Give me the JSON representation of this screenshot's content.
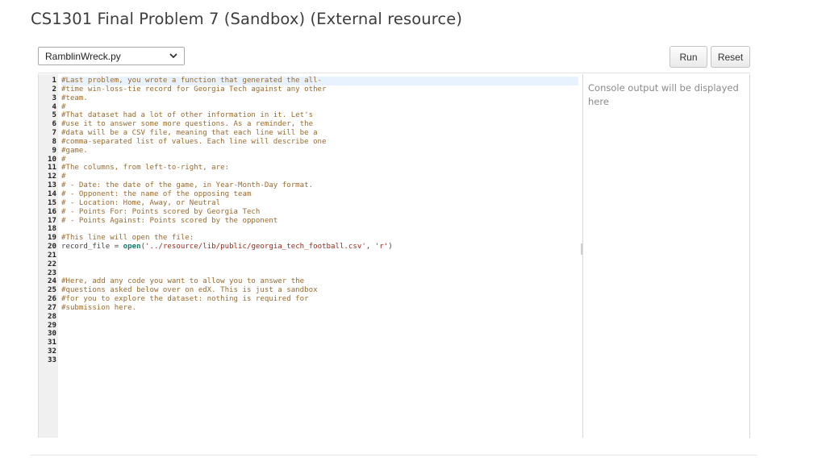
{
  "page": {
    "title": "CS1301 Final Problem 7 (Sandbox) (External resource)"
  },
  "toolbar": {
    "file_select_value": "RamblinWreck.py",
    "run_label": "Run",
    "reset_label": "Reset"
  },
  "editor": {
    "active_line": 1,
    "lines": [
      {
        "n": "1",
        "text": "#Last problem, you wrote a function that generated the all-"
      },
      {
        "n": "2",
        "text": "#time win-loss-tie record for Georgia Tech against any other"
      },
      {
        "n": "3",
        "text": "#team."
      },
      {
        "n": "4",
        "text": "#"
      },
      {
        "n": "5",
        "text": "#That dataset had a lot of other information in it. Let's"
      },
      {
        "n": "6",
        "text": "#use it to answer some more questions. As a reminder, the"
      },
      {
        "n": "7",
        "text": "#data will be a CSV file, meaning that each line will be a"
      },
      {
        "n": "8",
        "text": "#comma-separated list of values. Each line will describe one"
      },
      {
        "n": "9",
        "text": "#game."
      },
      {
        "n": "10",
        "text": "#"
      },
      {
        "n": "11",
        "text": "#The columns, from left-to-right, are:"
      },
      {
        "n": "12",
        "text": "#"
      },
      {
        "n": "13",
        "text": "# - Date: the date of the game, in Year-Month-Day format."
      },
      {
        "n": "14",
        "text": "# - Opponent: the name of the opposing team"
      },
      {
        "n": "15",
        "text": "# - Location: Home, Away, or Neutral"
      },
      {
        "n": "16",
        "text": "# - Points For: Points scored by Georgia Tech"
      },
      {
        "n": "17",
        "text": "# - Points Against: Points scored by the opponent"
      },
      {
        "n": "18",
        "text": ""
      },
      {
        "n": "19",
        "text": "#This line will open the file:"
      },
      {
        "n": "20",
        "text": "record_file = open('../resource/lib/public/georgia_tech_football.csv', 'r')"
      },
      {
        "n": "21",
        "text": ""
      },
      {
        "n": "22",
        "text": ""
      },
      {
        "n": "23",
        "text": ""
      },
      {
        "n": "24",
        "text": "#Here, add any code you want to allow you to answer the"
      },
      {
        "n": "25",
        "text": "#questions asked below over on edX. This is just a sandbox"
      },
      {
        "n": "26",
        "text": "#for you to explore the dataset: nothing is required for"
      },
      {
        "n": "27",
        "text": "#submission here."
      },
      {
        "n": "28",
        "text": ""
      },
      {
        "n": "29",
        "text": ""
      },
      {
        "n": "30",
        "text": ""
      },
      {
        "n": "31",
        "text": ""
      },
      {
        "n": "32",
        "text": ""
      },
      {
        "n": "33",
        "text": ""
      }
    ]
  },
  "console": {
    "placeholder": "Console output will be displayed here"
  },
  "colors": {
    "comment": "#9a6b2f",
    "keyword_fn": "#14786a",
    "string": "#9c2a1a",
    "active_line": "#e8f2ff"
  },
  "icons": {
    "select_chevron": "chevron-down-icon",
    "splitter_grip": "resize-grip-icon"
  }
}
